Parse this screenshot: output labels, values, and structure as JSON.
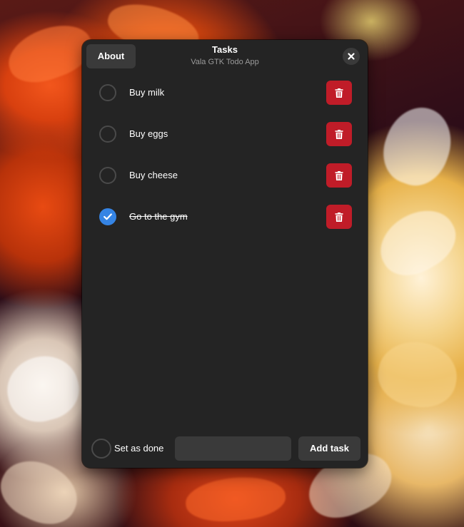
{
  "window": {
    "title": "Tasks",
    "subtitle": "Vala GTK Todo App",
    "about_label": "About",
    "close_icon": "close-icon"
  },
  "tasks": [
    {
      "label": "Buy milk",
      "done": false
    },
    {
      "label": "Buy eggs",
      "done": false
    },
    {
      "label": "Buy cheese",
      "done": false
    },
    {
      "label": "Go to the gym",
      "done": true
    }
  ],
  "footer": {
    "set_done_label": "Set as done",
    "set_done_checked": false,
    "entry_value": "",
    "entry_placeholder": "",
    "add_label": "Add task"
  },
  "colors": {
    "window_bg": "#242424",
    "button_bg": "#3a3a3a",
    "accent": "#3584e4",
    "destructive": "#c01c28"
  }
}
